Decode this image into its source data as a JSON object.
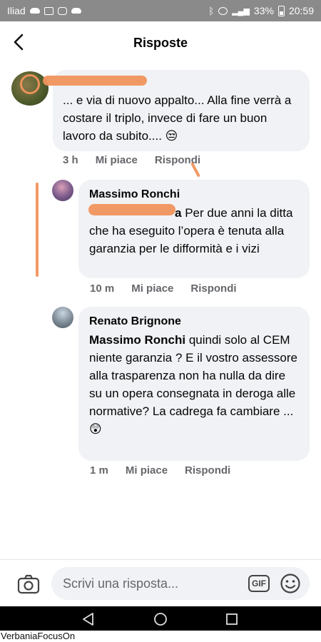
{
  "status_bar": {
    "carrier": "Iliad",
    "battery": "33%",
    "time": "20:59"
  },
  "header": {
    "title": "Risposte"
  },
  "comments": [
    {
      "author": "",
      "text": "... e via di nuovo appalto... Alla fine verrà a costare il triplo, invece di fare un buon lavoro da subito.... 😒",
      "time": "3 h",
      "like": "Mi piace",
      "reply": "Rispondi"
    },
    {
      "author": "Massimo Ronchi",
      "tag_visible": "a",
      "text": "Per due anni la ditta che ha eseguito l’opera è tenuta alla garanzia per le difformità e i vizi",
      "time": "10 m",
      "like": "Mi piace",
      "reply": "Rispondi"
    },
    {
      "author": "Renato Brignone",
      "tag": "Massimo Ronchi",
      "text": "quindi solo al CEM niente garanzia ? E il vostro assessore alla trasparenza non ha nulla da dire su un opera consegnata in deroga alle normative? La cadrega fa cambiare ... 😲",
      "time": "1 m",
      "like": "Mi piace",
      "reply": "Rispondi"
    }
  ],
  "composer": {
    "placeholder": "Scrivi una risposta...",
    "gif_label": "GIF"
  },
  "watermark": "VerbaniaFocusOn",
  "colors": {
    "bubble": "#f0f2f5",
    "meta_text": "#65676b",
    "scribble": "#f0945c",
    "status_bar": "#8a8a8a"
  },
  "icons": [
    "back-arrow-icon",
    "camera-icon",
    "gif-icon",
    "emoji-icon",
    "nav-back-icon",
    "nav-home-icon",
    "nav-recents-icon"
  ]
}
